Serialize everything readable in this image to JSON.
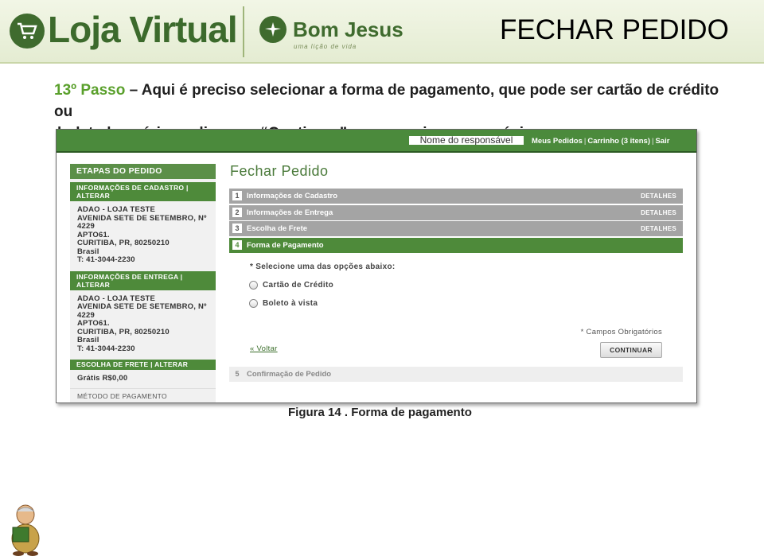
{
  "header": {
    "logo_text": "Loja Virtual",
    "partner_name": "Bom Jesus",
    "partner_tagline": "uma lição de vida",
    "page_title": "FECHAR PEDIDO"
  },
  "instructions": {
    "step_label": "13º Passo",
    "line1_rest": " – Aqui é preciso selecionar a forma de pagamento, que pode ser cartão de crédito ou",
    "line2": "boleto bancário, e clicar em “Continuar” para seguir para o próximo passo."
  },
  "store": {
    "topbar": {
      "responsible_name": "Nome do responsável",
      "links": [
        "Meus Pedidos",
        "Carrinho (3 itens)",
        "Sair"
      ]
    },
    "sidebar": {
      "heading": "ETAPAS DO PEDIDO",
      "cadastro_header": [
        "INFORMAÇÕES DE CADASTRO |",
        "ALTERAR"
      ],
      "cadastro_lines": [
        "ADAO - LOJA TESTE",
        "AVENIDA SETE DE SETEMBRO, Nº",
        "4229",
        "APTO61.",
        "CURITIBA, PR, 80250210",
        "Brasil",
        "T: 41-3044-2230"
      ],
      "entrega_header": [
        "INFORMAÇÕES DE ENTREGA |",
        "ALTERAR"
      ],
      "entrega_lines": [
        "ADAO - LOJA TESTE",
        "AVENIDA SETE DE SETEMBRO, Nº",
        "4229",
        "APTO61.",
        "CURITIBA, PR, 80250210",
        "Brasil",
        "T: 41-3044-2230"
      ],
      "frete_header": "ESCOLHA DE FRETE | ALTERAR",
      "frete_value": "Grátis R$0,00",
      "metodo": "MÉTODO DE PAGAMENTO"
    },
    "main_title": "Fechar Pedido",
    "steps": [
      {
        "num": "1",
        "title": "Informações de Cadastro",
        "detail": "DETALHES"
      },
      {
        "num": "2",
        "title": "Informações de Entrega",
        "detail": "DETALHES"
      },
      {
        "num": "3",
        "title": "Escolha de Frete",
        "detail": "DETALHES"
      },
      {
        "num": "4",
        "title": "Forma de Pagamento",
        "detail": ""
      }
    ],
    "payment": {
      "prompt": "* Selecione uma das opções abaixo:",
      "option_card": "Cartão de Crédito",
      "option_boleto": "Boleto à vista",
      "required_note": "* Campos Obrigatórios",
      "back_link": "« Voltar",
      "continue_button": "CONTINUAR"
    },
    "step5": {
      "num": "5",
      "title": "Confirmação de Pedido"
    }
  },
  "caption": "Figura 14 . Forma de pagamento",
  "colors": {
    "brand_green": "#3f6b2e",
    "step_green": "#5aa02c",
    "topbar_green": "#4b8a3c"
  }
}
